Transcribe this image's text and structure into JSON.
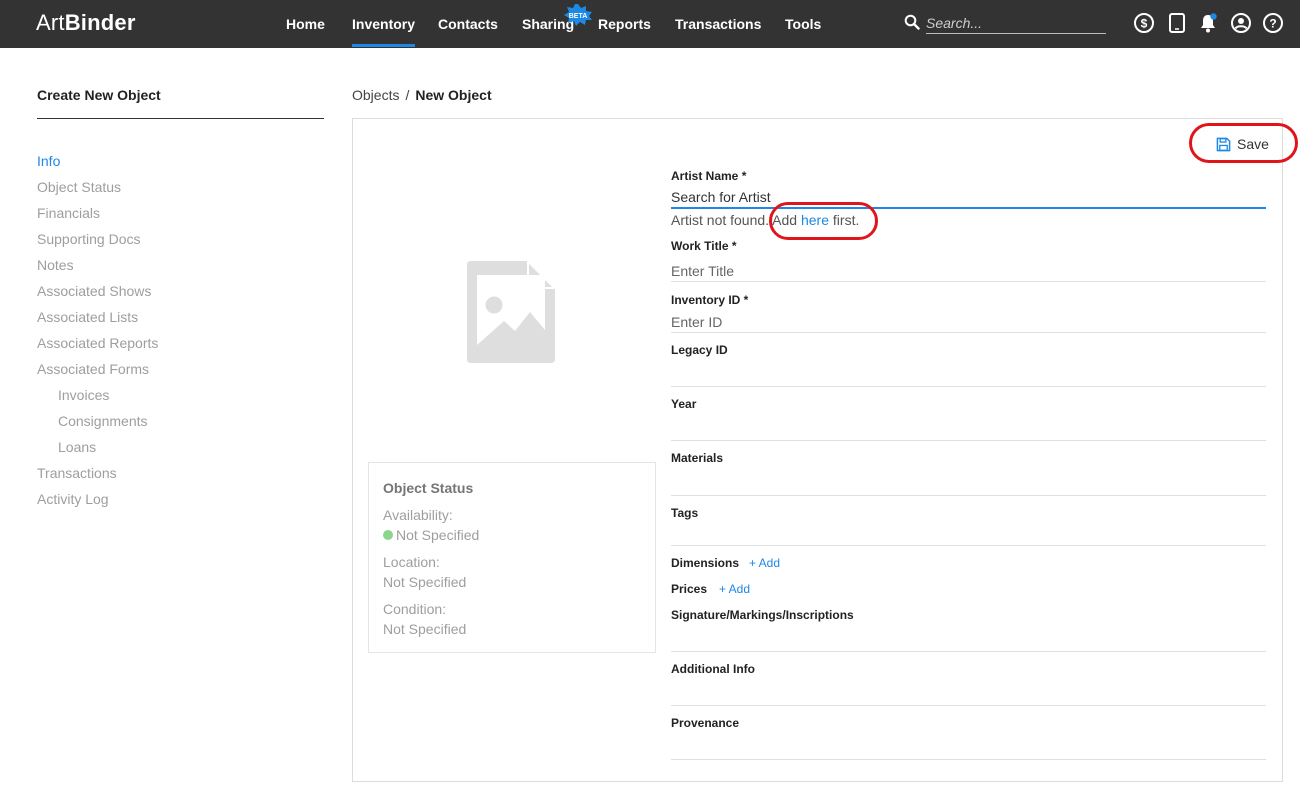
{
  "brand": {
    "part1": "Art",
    "part2": "Binder"
  },
  "nav": {
    "items": [
      "Home",
      "Inventory",
      "Contacts",
      "Sharing",
      "Reports",
      "Transactions",
      "Tools"
    ],
    "active": "Inventory",
    "beta_badge": "BETA"
  },
  "search": {
    "placeholder": "Search..."
  },
  "header_icons": [
    "dollar-circle-icon",
    "tablet-icon",
    "bell-icon",
    "user-circle-icon",
    "help-circle-icon"
  ],
  "sidebar": {
    "title": "Create New Object",
    "items": [
      "Info",
      "Object Status",
      "Financials",
      "Supporting Docs",
      "Notes",
      "Associated Shows",
      "Associated Lists",
      "Associated Reports",
      "Associated Forms",
      "Invoices",
      "Consignments",
      "Loans",
      "Transactions",
      "Activity Log"
    ],
    "active": "Info"
  },
  "breadcrumb": {
    "parent": "Objects",
    "separator": "/",
    "current": "New Object"
  },
  "toolbar": {
    "save_label": "Save"
  },
  "object_status": {
    "title": "Object Status",
    "availability_label": "Availability:",
    "availability_value": "Not Specified",
    "location_label": "Location:",
    "location_value": "Not Specified",
    "condition_label": "Condition:",
    "condition_value": "Not Specified"
  },
  "form": {
    "artist_name": {
      "label": "Artist Name *",
      "placeholder": "Search for Artist",
      "value": ""
    },
    "artist_hint": {
      "prefix": "Artist not found. Add ",
      "link": "here",
      "suffix": " first."
    },
    "work_title": {
      "label": "Work Title *",
      "placeholder": "Enter Title",
      "value": ""
    },
    "inventory_id": {
      "label": "Inventory ID *",
      "placeholder": "Enter ID",
      "value": ""
    },
    "legacy_id": {
      "label": "Legacy ID",
      "value": ""
    },
    "year": {
      "label": "Year",
      "value": ""
    },
    "materials": {
      "label": "Materials",
      "value": ""
    },
    "tags": {
      "label": "Tags",
      "value": ""
    },
    "dimensions": {
      "label": "Dimensions",
      "add": "+ Add"
    },
    "prices": {
      "label": "Prices",
      "add": "+ Add"
    },
    "signature": {
      "label": "Signature/Markings/Inscriptions",
      "value": ""
    },
    "additional_info": {
      "label": "Additional Info",
      "value": ""
    },
    "provenance": {
      "label": "Provenance",
      "value": ""
    }
  },
  "colors": {
    "topbar": "#333333",
    "accent": "#1e88e5",
    "highlight_circle": "#e0151c",
    "status_dot": "#8bd68b"
  }
}
